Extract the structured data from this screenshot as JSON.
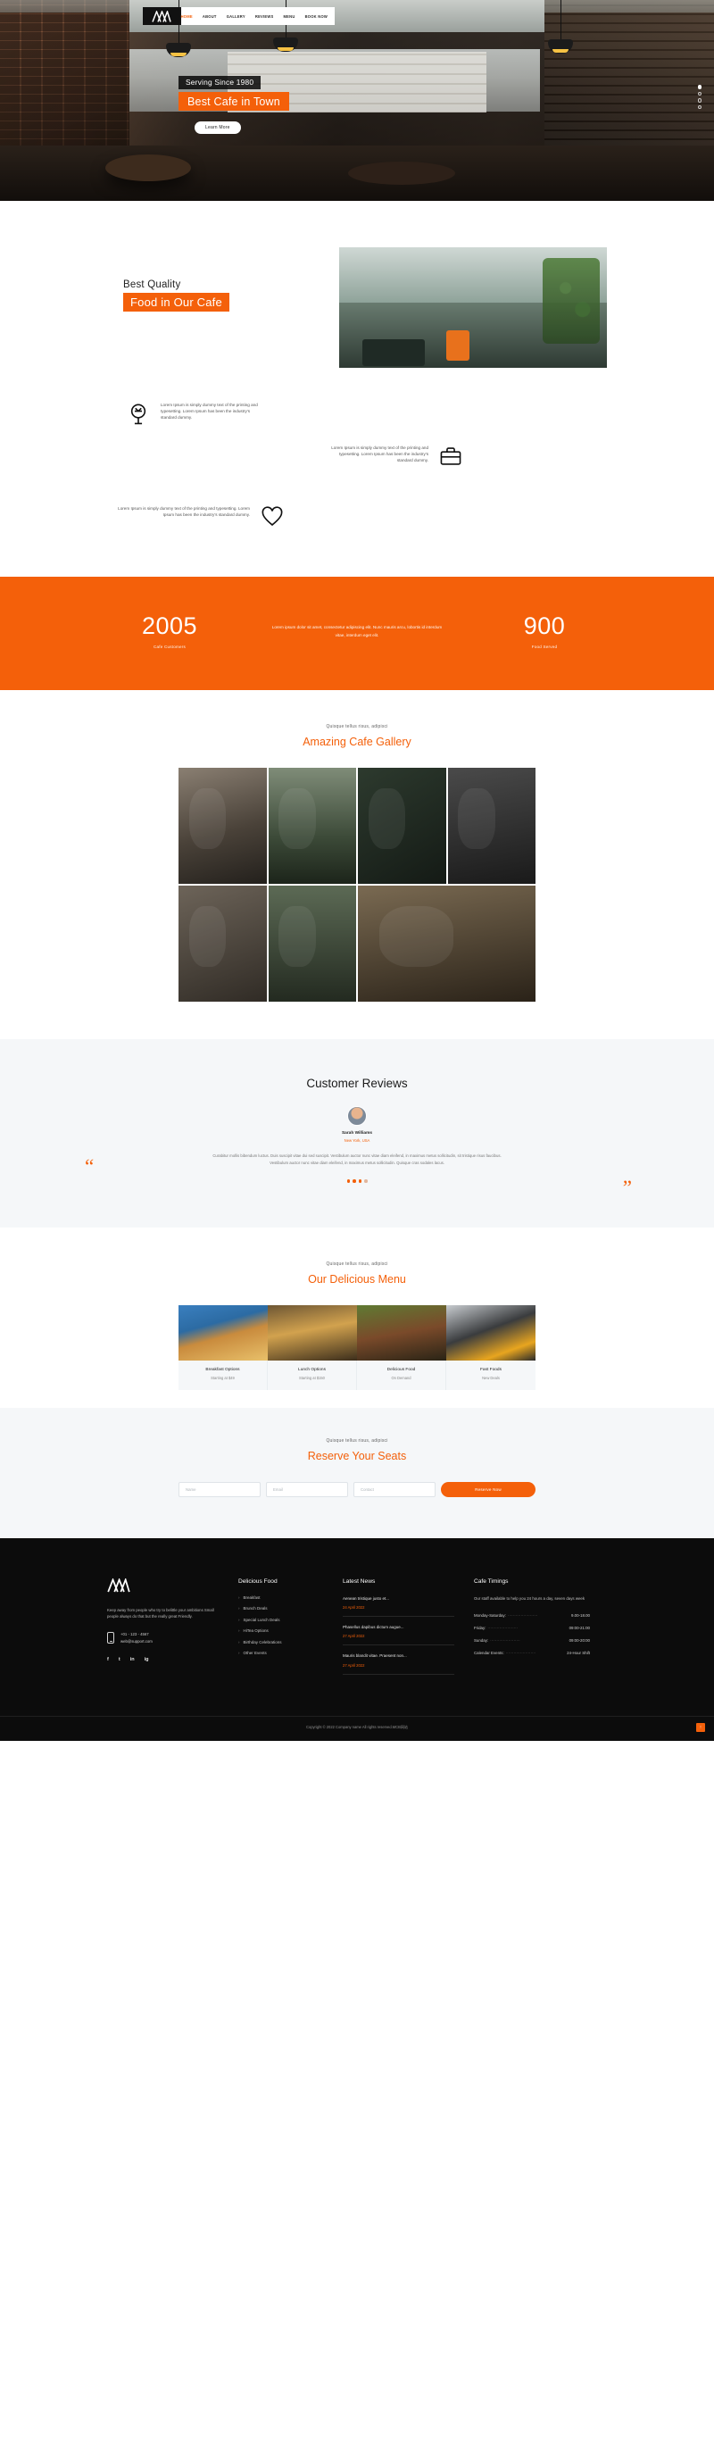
{
  "brand": {
    "logo_alt": "cafe-logo"
  },
  "nav": {
    "items": [
      {
        "label": "HOME",
        "active": true
      },
      {
        "label": "ABOUT",
        "active": false
      },
      {
        "label": "GALLERY",
        "active": false
      },
      {
        "label": "REVIEWS",
        "active": false
      },
      {
        "label": "MENU",
        "active": false
      },
      {
        "label": "BOOK NOW",
        "active": false
      }
    ]
  },
  "hero": {
    "kicker": "Serving Since 1980",
    "title": "Best Cafe in Town",
    "button": "Learn More",
    "slides": 4,
    "active_slide": 1
  },
  "about": {
    "subtitle": "Best Quality",
    "heading": "Food in Our Cafe",
    "features": [
      {
        "icon": "lightbulb-icon",
        "text": "Lorem Ipsum is simply dummy text of the printing and typesetting. Lorem Ipsum has been the industry’s standard dummy."
      },
      {
        "icon": "briefcase-icon",
        "text": "Lorem Ipsum is simply dummy text of the printing and typesetting. Lorem Ipsum has been the industry’s standard dummy."
      },
      {
        "icon": "heart-icon",
        "text": "Lorem Ipsum is simply dummy text of the printing and typesetting. Lorem Ipsum has been the industry’s standard dummy."
      }
    ]
  },
  "stats": {
    "left": {
      "number": "2005",
      "label": "Cafe Customers"
    },
    "text": "Lorem ipsum dolor sit amet, consectetur adipiscing elit. Nunc mauris arcu, lobortis id interdum vitae, interdum eget elit.",
    "right": {
      "number": "900",
      "label": "Food Served"
    }
  },
  "gallery": {
    "kicker": "Quisque tellus risus, adipisci",
    "title": "Amazing Cafe Gallery"
  },
  "reviews": {
    "title": "Customer Reviews",
    "name": "Sarah Williams",
    "role": "New York, USA",
    "text": "Curabitur mollis bibendum luctus. Duis suscipit vitae dui sed suscipit. Vestibulum auctor nunc vitae diam eleifend, in maximus metus sollicitudin, sit tristique risus faucibus. Vestibulum auctor nunc vitae diam eleifend, in maximus metus sollicitudin. Quisque cras sodales lacus.",
    "dots": 4,
    "active_dot": 1
  },
  "menu": {
    "kicker": "Quisque tellus risus, adipisci",
    "title": "Our Delicious Menu",
    "items": [
      {
        "name": "Breakfast Options",
        "price": "Starting at $49"
      },
      {
        "name": "Lunch Options",
        "price": "Starting at $150"
      },
      {
        "name": "Delicious Food",
        "price": "On Demand"
      },
      {
        "name": "Fast Foods",
        "price": "New Deals"
      }
    ]
  },
  "reserve": {
    "kicker": "Quisque tellus risus, adipisci",
    "title": "Reserve Your Seats",
    "fields": [
      {
        "placeholder": "Name",
        "value": ""
      },
      {
        "placeholder": "Email",
        "value": ""
      },
      {
        "placeholder": "Contact",
        "value": ""
      }
    ],
    "button": "Reserve Now"
  },
  "footer": {
    "about": "Keep away from people who try to belittle your ambitions Small people always do that but the really great Friendly.",
    "phone": "+01 - 123 - 4567",
    "email": "web@support.com",
    "socials": [
      "f",
      "t",
      "in",
      "ig"
    ],
    "food": {
      "heading": "Delicious Food",
      "links": [
        "Breakfast",
        "Brunch Deals",
        "Special Lunch Deals",
        "HiTea Options",
        "Birthday Celebrations",
        "Other Events"
      ]
    },
    "news": {
      "heading": "Latest News",
      "items": [
        {
          "title": "Aenean tristique justo et...",
          "date": "24 April 2022"
        },
        {
          "title": "Phasellus dapibus dictum augue...",
          "date": "27 April 2022"
        },
        {
          "title": "Mauris blandit vitae. Praesent non...",
          "date": "27 April 2022"
        }
      ]
    },
    "timings": {
      "heading": "Cafe Timings",
      "note": "Our staff available to help you 24 hours a day, seven days week",
      "rows": [
        {
          "key": "Monday-Saturday:",
          "value": "9.00-18.00"
        },
        {
          "key": "Friday:",
          "value": "09:00-21:00"
        },
        {
          "key": "Sunday:",
          "value": "09:00-20:00"
        },
        {
          "key": "Calendar Events:",
          "value": "24-Hour Shift"
        }
      ]
    },
    "copyright": "Copyright © 2022 Company name All rights reserved.MCB网站",
    "to_top": "↑"
  },
  "colors": {
    "accent": "#f4600a",
    "dark": "#0c0c0c",
    "light_bg": "#f5f7f9"
  }
}
